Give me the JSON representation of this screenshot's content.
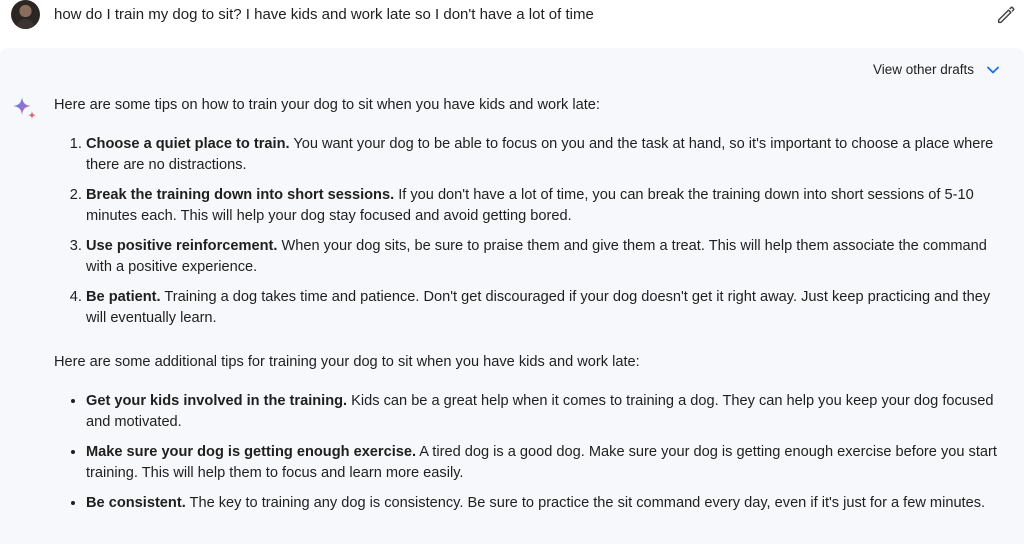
{
  "prompt": {
    "text": "how do I train my dog to sit? I have kids and work late so I don't have a lot of time"
  },
  "response": {
    "drafts_label": "View other drafts",
    "intro": "Here are some tips on how to train your dog to sit when you have kids and work late:",
    "numbered_tips": [
      {
        "title": "Choose a quiet place to train.",
        "body": " You want your dog to be able to focus on you and the task at hand, so it's important to choose a place where there are no distractions."
      },
      {
        "title": "Break the training down into short sessions.",
        "body": " If you don't have a lot of time, you can break the training down into short sessions of 5-10 minutes each. This will help your dog stay focused and avoid getting bored."
      },
      {
        "title": "Use positive reinforcement.",
        "body": " When your dog sits, be sure to praise them and give them a treat. This will help them associate the command with a positive experience."
      },
      {
        "title": "Be patient.",
        "body": " Training a dog takes time and patience. Don't get discouraged if your dog doesn't get it right away. Just keep practicing and they will eventually learn."
      }
    ],
    "additional_intro": "Here are some additional tips for training your dog to sit when you have kids and work late:",
    "bullet_tips": [
      {
        "title": "Get your kids involved in the training.",
        "body": " Kids can be a great help when it comes to training a dog. They can help you keep your dog focused and motivated."
      },
      {
        "title": "Make sure your dog is getting enough exercise.",
        "body": " A tired dog is a good dog. Make sure your dog is getting enough exercise before you start training. This will help them to focus and learn more easily."
      },
      {
        "title": "Be consistent.",
        "body": " The key to training any dog is consistency. Be sure to practice the sit command every day, even if it's just for a few minutes."
      }
    ]
  },
  "icons": {
    "avatar": "user-avatar",
    "edit": "pencil-icon",
    "drafts_toggle": "chevron-down-icon",
    "assistant": "sparkle-icon"
  },
  "colors": {
    "card_background": "#f7f8fb",
    "chevron": "#1a73e8",
    "sparkle_blue": "#4285f4",
    "sparkle_red": "#d96570"
  }
}
